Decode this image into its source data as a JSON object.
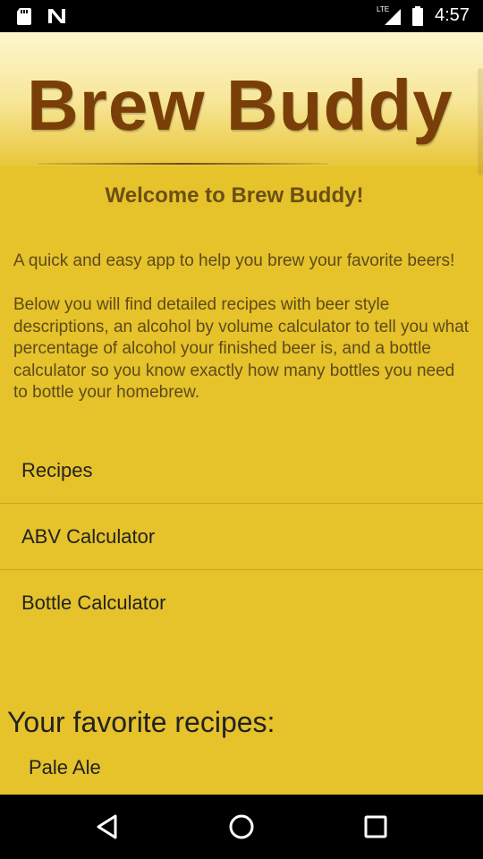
{
  "status_bar": {
    "time": "4:57",
    "network": "LTE",
    "icons": [
      "sd-card-icon",
      "n-notification-icon",
      "lte-signal-icon",
      "battery-icon"
    ]
  },
  "header": {
    "app_title": "Brew Buddy"
  },
  "welcome": {
    "title": "Welcome to Brew Buddy!",
    "paragraph_1": "A quick and easy app to help you brew your favorite beers!",
    "paragraph_2": " Below you will find detailed recipes with beer style descriptions, an alcohol by volume calculator to tell you what percentage of alcohol your finished beer is, and a bottle calculator so you know exactly how many bottles you need to bottle your homebrew."
  },
  "menu": {
    "items": [
      {
        "label": "Recipes"
      },
      {
        "label": "ABV Calculator"
      },
      {
        "label": "Bottle Calculator"
      }
    ]
  },
  "favorites": {
    "heading": "Your favorite recipes:",
    "items": [
      {
        "label": "Pale Ale"
      }
    ]
  },
  "colors": {
    "background": "#e6c22b",
    "logo": "#7a3f08",
    "welcome_title": "#6b4f14",
    "body_text": "#5e4b1a"
  }
}
